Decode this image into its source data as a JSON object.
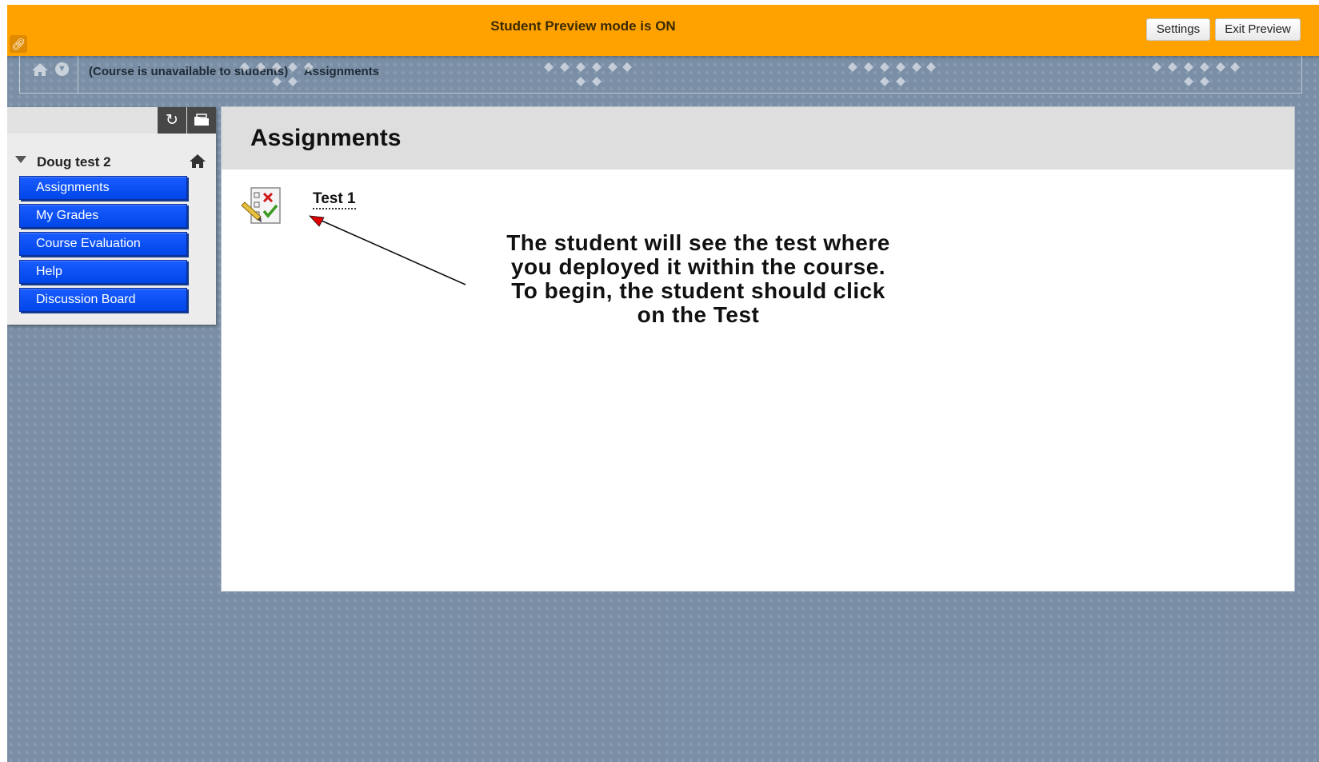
{
  "preview_bar": {
    "title": "Student Preview mode is ON",
    "settings_label": "Settings",
    "exit_label": "Exit Preview"
  },
  "breadcrumb": {
    "items": [
      "(Course is unavailable to students)",
      "Assignments"
    ]
  },
  "course_menu": {
    "course_title": "Doug test 2",
    "items": [
      {
        "label": "Assignments"
      },
      {
        "label": "My Grades"
      },
      {
        "label": "Course Evaluation"
      },
      {
        "label": "Help"
      },
      {
        "label": "Discussion Board"
      }
    ]
  },
  "content": {
    "page_title": "Assignments",
    "items": [
      {
        "label": "Test 1",
        "icon": "test-icon"
      }
    ],
    "annotation_lines": [
      "The student will see the test where",
      "you deployed it within the course.",
      "To begin, the student should click",
      "on the Test"
    ]
  },
  "colors": {
    "preview_banner": "#ffa200",
    "page_background": "#7a8fa6",
    "menu_item": "#0046e8",
    "annotation_arrow": "#e00000"
  }
}
